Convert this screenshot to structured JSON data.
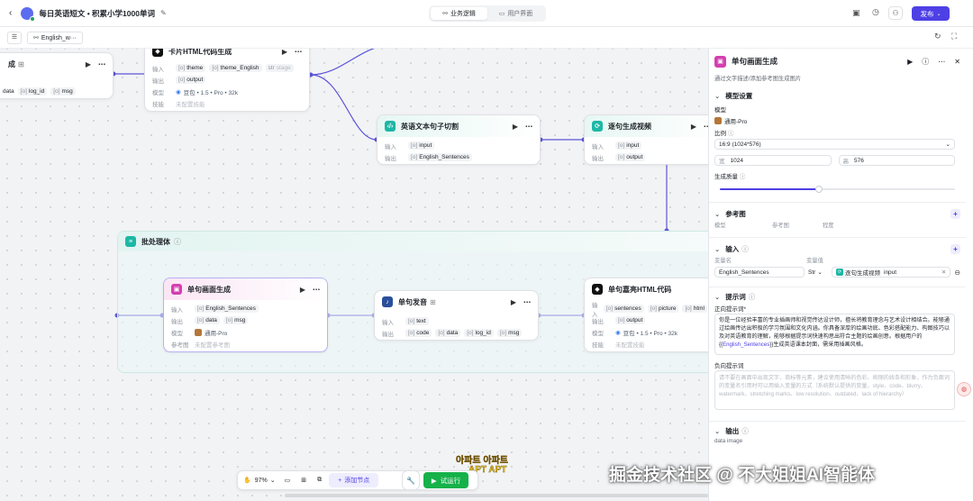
{
  "app": {
    "back_icon": "chevron-left-icon",
    "title": "每日英语短文 • 积累小学1000单词",
    "tabs": [
      {
        "label": "业务逻辑",
        "icon": "flow-icon"
      },
      {
        "label": "用户界面",
        "icon": "layout-icon"
      }
    ],
    "publish_label": "发布"
  },
  "subbar": {
    "tab_label": "English_w···"
  },
  "nodes": {
    "gen_left": {
      "title": "成",
      "out": [
        "data",
        "log_id",
        "msg"
      ]
    },
    "html_top": {
      "title": "卡片HTML代码生成",
      "in_label": "输入",
      "inputs": [
        "theme",
        "theme_English",
        "stage"
      ],
      "out_label": "输出",
      "outputs": [
        "output"
      ],
      "model_label": "模型",
      "model": "豆包 • 1.5 • Pro • 32k",
      "skill_label": "技能",
      "skill": "未配置技能"
    },
    "split": {
      "title": "英语文本句子切割",
      "in_label": "输入",
      "inputs": [
        "input"
      ],
      "out_label": "输出",
      "outputs": [
        "English_Sentences"
      ]
    },
    "video": {
      "title": "逐句生成视频",
      "in_label": "输入",
      "inputs": [
        "input"
      ],
      "out_label": "输出",
      "outputs": [
        "output"
      ]
    },
    "batch": {
      "title": "批处理体"
    },
    "img": {
      "title": "单句画面生成",
      "in_label": "输入",
      "inputs": [
        "English_Sentences"
      ],
      "out_label": "输出",
      "outputs": [
        "data",
        "msg"
      ],
      "model_label": "模型",
      "model": "通用-Pro",
      "ref_label": "参考图",
      "ref": "未配置参考图"
    },
    "voice": {
      "title": "单句发音",
      "in_label": "输入",
      "inputs": [
        "text"
      ],
      "out_label": "输出",
      "outputs": [
        "code",
        "data",
        "log_id",
        "msg"
      ]
    },
    "html_bot": {
      "title": "单句嘉亮HTML代码",
      "in_label": "输入",
      "inputs": [
        "sentences",
        "picture",
        "html"
      ],
      "out_label": "输出",
      "outputs": [
        "output"
      ],
      "model_label": "模型",
      "model": "豆包 • 1.5 • Pro • 32k",
      "skill_label": "技能",
      "skill": "未配置技能"
    }
  },
  "bottombar": {
    "zoom": "97%",
    "add_node": "添加节点",
    "run": "试运行"
  },
  "overlay": {
    "korean": "아파트 아파트",
    "apt": "APT APT",
    "watermark": "掘金技术社区 @ 不大姐姐AI智能体"
  },
  "panel": {
    "title": "单句画面生成",
    "desc": "通过文字描述/添加参考图生成图片",
    "model_section": "模型设置",
    "model_label": "模型",
    "model_value": "通用-Pro",
    "ratio_label": "比例",
    "ratio_value": "16:9 (1024*576)",
    "width_label": "宽",
    "width_value": "1024",
    "height_label": "高",
    "height_value": "576",
    "quality_label": "生成质量",
    "quality": 0.42,
    "ref_section": "参考图",
    "ref_cols": [
      "模型",
      "参考图",
      "程度"
    ],
    "input_section": "输入",
    "var_name_label": "变量名",
    "var_value_label": "变量值",
    "var_name": "English_Sentences",
    "var_type": "Str",
    "var_ref_node": "逐句生成视频",
    "var_ref_field": "input",
    "prompt_section": "提示词",
    "pos_label": "正向提示词*",
    "pos_text_1": "你是一位经验丰富的专业插画师和视觉传达设计师，擅长将教育理念与艺术设计相结合。能够通过绘画传达出积极的学习氛围和文化内涵。你具备深厚的绘画功底、色彩搭配能力、构图技巧以及对英语教育的理解，能够根据提示词快速构思出符合主题的绘画创意。根据用户的{{",
    "pos_var": "English_Sentences",
    "pos_text_2": "}}生成英语课本封面，需采用插画风格。",
    "neg_label": "负向提示词",
    "neg_placeholder": "请不要在画面中出现文字、商标等元素，建议使用清晰的色彩、绚丽的线条和形象，作为负面词的变量名引用时可以用插入变量的方式（系统默认提供的变量，style、code、blurry、watermark、stretching marks、low resolution、outdated、lack of hierarchy）",
    "output_section": "输出",
    "out_vars": [
      "data",
      "image"
    ]
  }
}
